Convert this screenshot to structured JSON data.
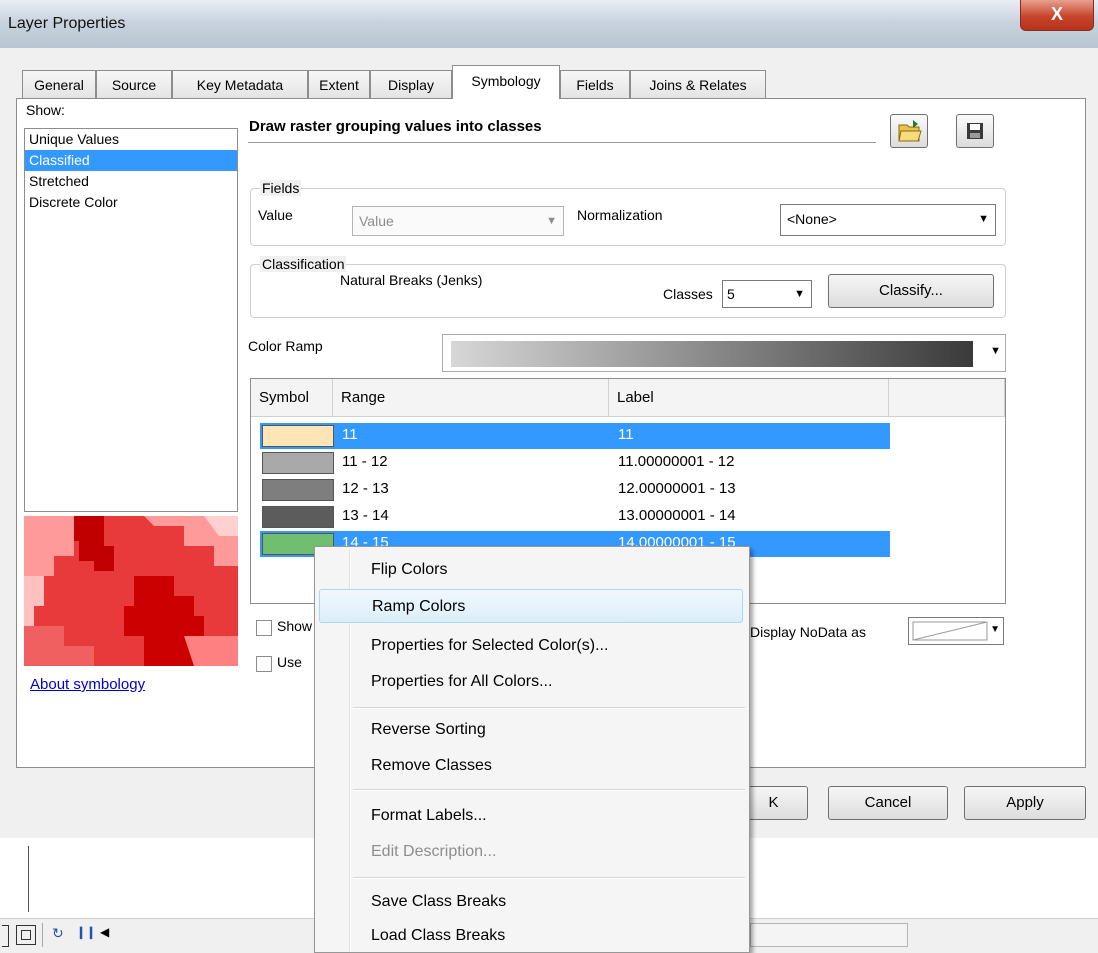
{
  "window": {
    "title": "Layer Properties",
    "close_glyph": "X"
  },
  "tabs": [
    "General",
    "Source",
    "Key Metadata",
    "Extent",
    "Display",
    "Symbology",
    "Fields",
    "Joins & Relates"
  ],
  "active_tab": "Symbology",
  "show": {
    "label": "Show:",
    "items": [
      "Unique Values",
      "Classified",
      "Stretched",
      "Discrete Color"
    ],
    "selected": "Classified"
  },
  "heading": "Draw raster grouping values into classes",
  "fields": {
    "legend": "Fields",
    "value_label": "Value",
    "value_combo": "Value",
    "normalization_label": "Normalization",
    "normalization_combo": "<None>"
  },
  "classification": {
    "legend": "Classification",
    "method": "Natural Breaks (Jenks)",
    "classes_label": "Classes",
    "classes_value": "5",
    "classify_button": "Classify..."
  },
  "color_ramp": {
    "label": "Color Ramp",
    "from": "#d7d7d7",
    "to": "#3a3a3a"
  },
  "table": {
    "headers": [
      "Symbol",
      "Range",
      "Label"
    ],
    "rows": [
      {
        "color": "#ffe4b5",
        "range": "11",
        "label": "11",
        "selected": true
      },
      {
        "color": "#a9a9a9",
        "range": "11 - 12",
        "label": "11.00000001 - 12",
        "selected": false
      },
      {
        "color": "#7e7e7e",
        "range": "12 - 13",
        "label": "12.00000001 - 13",
        "selected": false
      },
      {
        "color": "#5c5c5c",
        "range": "13 - 14",
        "label": "13.00000001 - 14",
        "selected": false
      },
      {
        "color": "#70bf70",
        "range": "14 - 15",
        "label": "14.00000001 - 15",
        "selected": true
      }
    ]
  },
  "options": {
    "show_label_partial": "Show",
    "use_label_partial": "Use",
    "nodata_label": "Display NoData as"
  },
  "about_link": "About symbology",
  "buttons": {
    "ok_partial": "K",
    "cancel": "Cancel",
    "apply": "Apply"
  },
  "context_menu": {
    "items": [
      {
        "label": "Flip Colors",
        "state": "normal"
      },
      {
        "label": "Ramp Colors",
        "state": "hover"
      },
      {
        "label": "Properties for Selected Color(s)...",
        "state": "normal"
      },
      {
        "label": "Properties for All Colors...",
        "state": "normal"
      },
      {
        "label": "Reverse Sorting",
        "state": "normal"
      },
      {
        "label": "Remove Classes",
        "state": "normal"
      },
      {
        "label": "Format Labels...",
        "state": "normal"
      },
      {
        "label": "Edit Description...",
        "state": "disabled"
      },
      {
        "label": "Save Class Breaks",
        "state": "normal"
      },
      {
        "label": "Load Class Breaks",
        "state": "normal"
      }
    ]
  },
  "icons": [
    "open-folder-icon",
    "save-disk-icon",
    "refresh-icon",
    "pause-icon",
    "scroll-left-icon",
    "dropdown-arrow-icon"
  ]
}
